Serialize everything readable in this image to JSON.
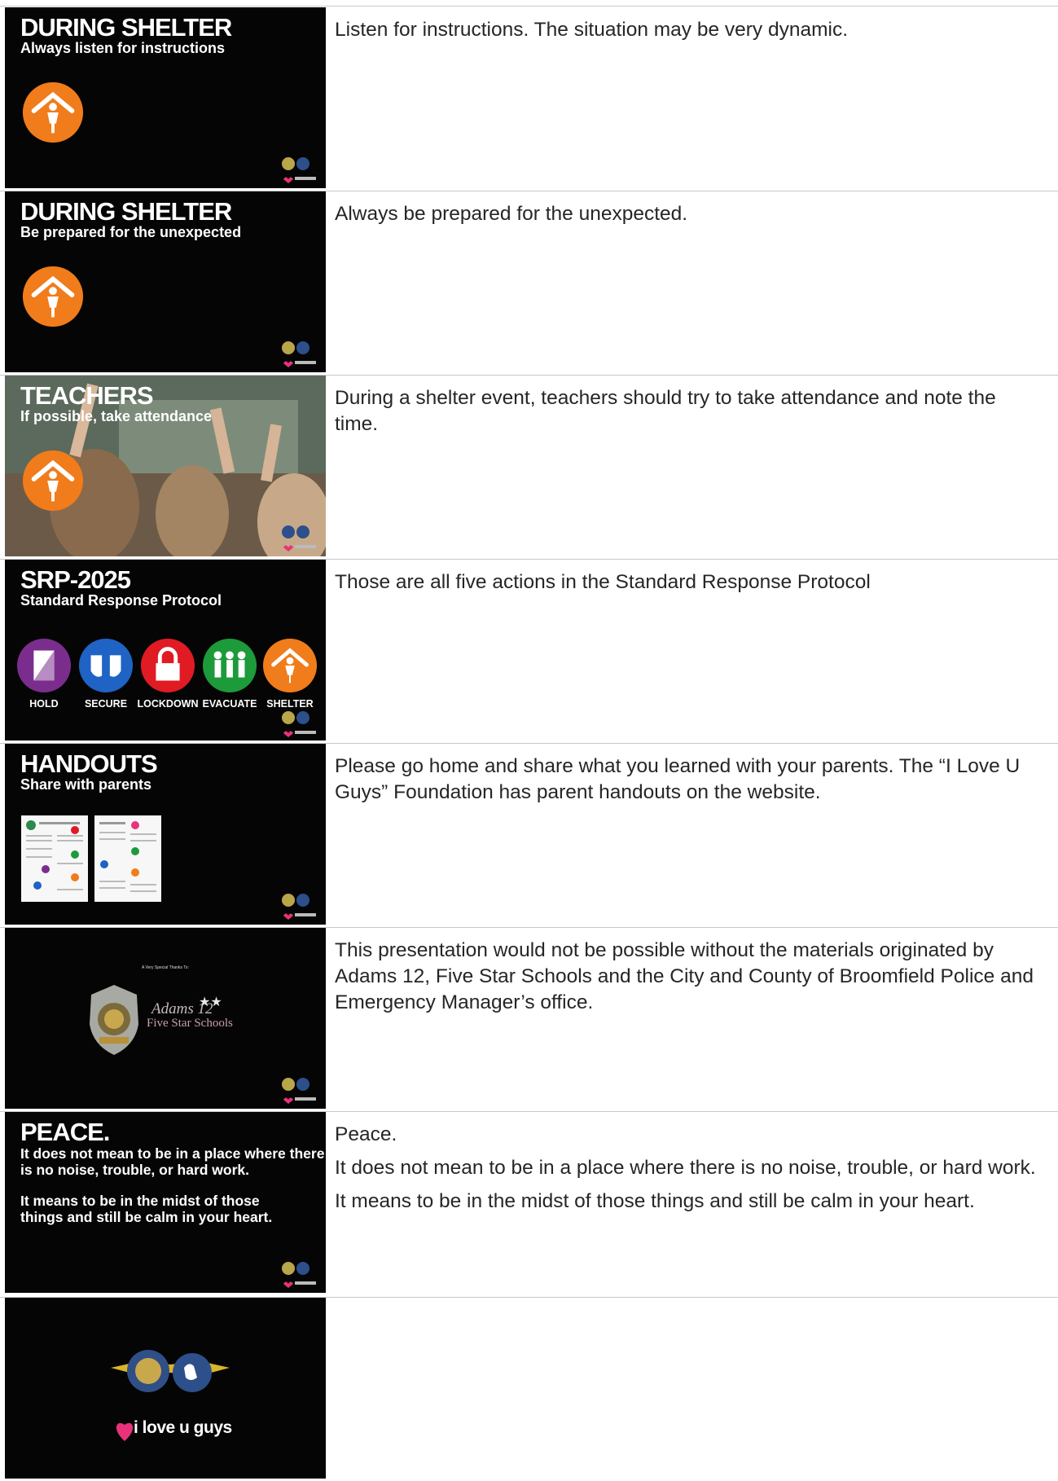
{
  "slides": [
    {
      "title": "DURING SHELTER",
      "subtitle": "Always listen for instructions",
      "notes": [
        "Listen for instructions. The situation may be very dynamic."
      ]
    },
    {
      "title": "DURING SHELTER",
      "subtitle": "Be prepared for the unexpected",
      "notes": [
        "Always be prepared for the unexpected."
      ]
    },
    {
      "title": "TEACHERS",
      "subtitle": "If possible, take attendance",
      "notes": [
        "During a shelter event, teachers should try to take attendance and note the time."
      ]
    },
    {
      "title": "SRP-2025",
      "subtitle": "Standard Response Protocol",
      "actions": [
        "HOLD",
        "SECURE",
        "LOCKDOWN",
        "EVACUATE",
        "SHELTER"
      ],
      "action_colors": [
        "#7b2d8e",
        "#1f63c4",
        "#e01b24",
        "#1d9a3a",
        "#f07c1b"
      ],
      "notes": [
        "Those are all five actions in the Standard Response Protocol"
      ]
    },
    {
      "title": "HANDOUTS",
      "subtitle": "Share with parents",
      "notes": [
        "Please go home and share what you learned with your parents. The “I Love U Guys” Foundation has parent handouts on the website."
      ]
    },
    {
      "heading": "A Very Special Thanks To:",
      "school_logo_line1": "Adams 12",
      "school_logo_line2": "Five Star Schools",
      "notes": [
        "This presentation would not be possible without the materials originated by Adams 12, Five Star Schools and the City and County of Broomfield Police and Emergency Manager’s office."
      ]
    },
    {
      "title": "PEACE.",
      "body_1": "It does not mean to be in a place where there is no noise, trouble, or hard work.",
      "body_2": "It means to be in the midst of those things and still be calm in your heart.",
      "notes": [
        "Peace.",
        "It does not mean to be in a place where there is no noise, trouble, or hard work.",
        "It means to be in the midst of those things and still be calm in your heart."
      ]
    },
    {
      "brand": "i love u guys",
      "notes": []
    }
  ],
  "colors": {
    "shelter_orange": "#f07c1b",
    "slide_bg": "#050505",
    "brand_pink": "#e8337a"
  }
}
